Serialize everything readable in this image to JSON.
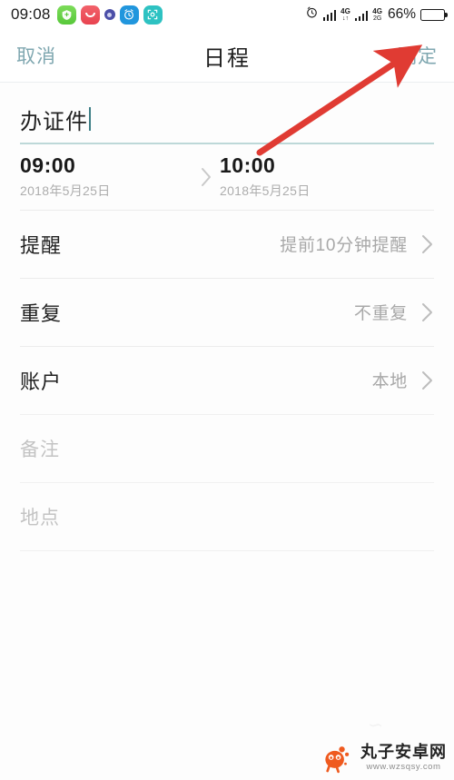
{
  "status_bar": {
    "time": "09:08",
    "left_icons": [
      {
        "name": "shield-plus-icon",
        "color": "#57c83a"
      },
      {
        "name": "red-smile-icon",
        "color": "#e8434f"
      },
      {
        "name": "purple-dot-icon",
        "color": "#4b4fa8"
      },
      {
        "name": "blue-alarm-app-icon",
        "color": "#2196dd"
      },
      {
        "name": "teal-scan-app-icon",
        "color": "#2ec2c2"
      }
    ],
    "alarm_icon": "alarm-clock-icon",
    "signal_1_label": "4G",
    "signal_1_sub": "↓↑",
    "signal_2_label": "4G",
    "signal_2_sub": "2G",
    "battery_percent": "66%"
  },
  "navbar": {
    "cancel_label": "取消",
    "title": "日程",
    "confirm_label": "确定",
    "accent_color": "#7fa7b0"
  },
  "title_field": {
    "value": "办证件",
    "underline_color": "#bdd8d8"
  },
  "time_row": {
    "start_time": "09:00",
    "start_date": "2018年5月25日",
    "separator_icon": "chevron-right-icon",
    "end_time": "10:00",
    "end_date": "2018年5月25日"
  },
  "rows": [
    {
      "label": "提醒",
      "value": "提前10分钟提醒",
      "chevron": "chevron-right-icon",
      "name": "reminder"
    },
    {
      "label": "重复",
      "value": "不重复",
      "chevron": "chevron-right-icon",
      "name": "repeat"
    },
    {
      "label": "账户",
      "value": "本地",
      "chevron": "chevron-right-icon",
      "name": "account"
    }
  ],
  "placeholders": [
    {
      "text": "备注",
      "name": "notes"
    },
    {
      "text": "地点",
      "name": "location"
    }
  ],
  "annotation": {
    "type": "arrow",
    "color": "#e03b33",
    "points_to": "确定"
  },
  "watermark": {
    "site_name": "丸子安卓网",
    "url": "www.wzsqsy.com",
    "logo_color": "#ef5a1f",
    "ghost_mark": "∽"
  }
}
